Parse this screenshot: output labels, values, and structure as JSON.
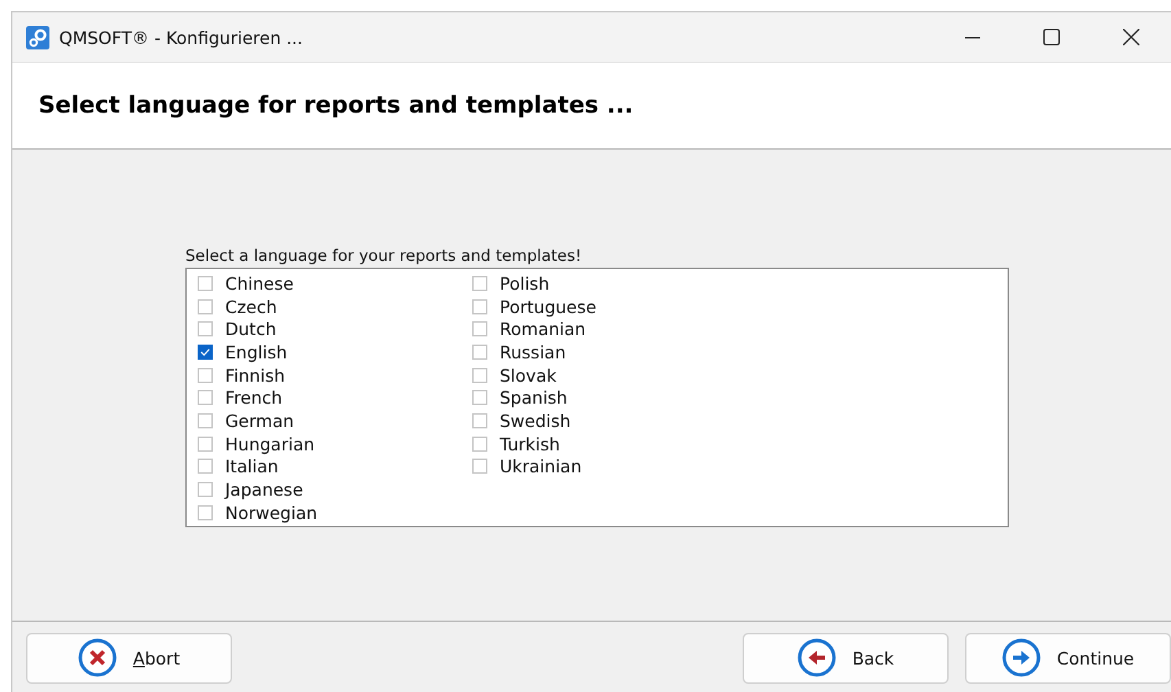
{
  "window": {
    "title": "QMSOFT® - Konfigurieren ..."
  },
  "header": {
    "title": "Select language for reports and templates ..."
  },
  "language_list": {
    "label": "Select a language for your reports and templates!",
    "items": [
      {
        "label": "Chinese",
        "checked": false
      },
      {
        "label": "Czech",
        "checked": false
      },
      {
        "label": "Dutch",
        "checked": false
      },
      {
        "label": "English",
        "checked": true
      },
      {
        "label": "Finnish",
        "checked": false
      },
      {
        "label": "French",
        "checked": false
      },
      {
        "label": "German",
        "checked": false
      },
      {
        "label": "Hungarian",
        "checked": false
      },
      {
        "label": "Italian",
        "checked": false
      },
      {
        "label": "Japanese",
        "checked": false
      },
      {
        "label": "Norwegian",
        "checked": false
      },
      {
        "label": "Polish",
        "checked": false
      },
      {
        "label": "Portuguese",
        "checked": false
      },
      {
        "label": "Romanian",
        "checked": false
      },
      {
        "label": "Russian",
        "checked": false
      },
      {
        "label": "Slovak",
        "checked": false
      },
      {
        "label": "Spanish",
        "checked": false
      },
      {
        "label": "Swedish",
        "checked": false
      },
      {
        "label": "Turkish",
        "checked": false
      },
      {
        "label": "Ukrainian",
        "checked": false
      }
    ]
  },
  "buttons": [
    {
      "kind": "abort",
      "label": "Abort",
      "access_key_underlined": true
    },
    {
      "kind": "back",
      "label": "Back",
      "access_key_underlined": false
    },
    {
      "kind": "continue",
      "label": "Continue",
      "access_key_underlined": false
    }
  ]
}
